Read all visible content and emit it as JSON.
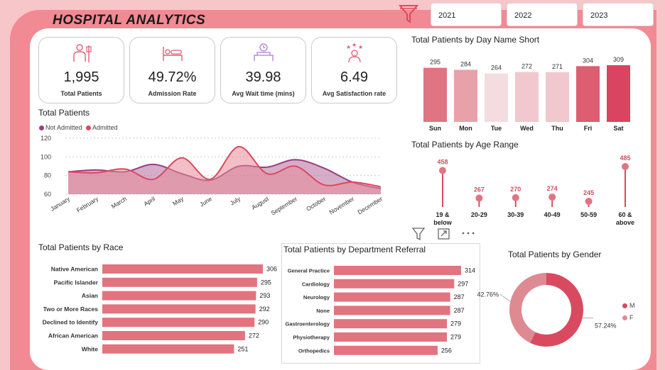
{
  "title": "HOSPITAL  ANALYTICS",
  "years": [
    "2021",
    "2022",
    "2023"
  ],
  "kpis": [
    {
      "value": "1,995",
      "label": "Total Patients",
      "icon": "patient-icon"
    },
    {
      "value": "49.72%",
      "label": "Admission Rate",
      "icon": "hospital-bed-icon"
    },
    {
      "value": "39.98",
      "label": "Avg Wait time (mins)",
      "icon": "waiting-clock-icon"
    },
    {
      "value": "6.49",
      "label": "Avg Satisfaction rate",
      "icon": "satisfaction-stars-icon"
    }
  ],
  "colors": {
    "accent": "#d94a60",
    "bar": "#e2747f",
    "purple": "#9c3d7d",
    "band": "#f28a93",
    "background": "#f7c6c9"
  },
  "total_patients": {
    "title": "Total Patients",
    "legend": [
      "Not Admitted",
      "Admitted"
    ]
  },
  "day_chart": {
    "title": "Total Patients by Day Name Short"
  },
  "age_chart": {
    "title": "Total Patients by Age Range"
  },
  "race_chart": {
    "title": "Total Patients by Race"
  },
  "dept_chart": {
    "title": "Total Patients by Department Referral"
  },
  "gender_chart": {
    "title": "Total Patients by Gender"
  },
  "chart_data": [
    {
      "type": "area",
      "title": "Total Patients",
      "categories": [
        "January",
        "February",
        "March",
        "April",
        "May",
        "June",
        "July",
        "August",
        "September",
        "October",
        "November",
        "December"
      ],
      "ylim": [
        60,
        120
      ],
      "yticks": [
        60,
        80,
        100,
        120
      ],
      "grid": true,
      "legend": "top-left",
      "series": [
        {
          "name": "Not Admitted",
          "values": [
            84,
            86,
            84,
            92,
            82,
            75,
            90,
            89,
            97,
            88,
            73,
            66
          ]
        },
        {
          "name": "Admitted",
          "values": [
            84,
            83,
            87,
            76,
            99,
            76,
            111,
            82,
            90,
            70,
            73,
            68
          ]
        }
      ]
    },
    {
      "type": "bar",
      "title": "Total Patients by Day Name Short",
      "categories": [
        "Sun",
        "Mon",
        "Tue",
        "Wed",
        "Thu",
        "Fri",
        "Sat"
      ],
      "values": [
        295,
        284,
        264,
        272,
        271,
        304,
        309
      ],
      "colors": [
        "#e07482",
        "#e8a1a9",
        "#f4dcdf",
        "#f0c8cd",
        "#f0c8cd",
        "#dc5e70",
        "#d94561"
      ]
    },
    {
      "type": "scatter",
      "title": "Total Patients by Age Range",
      "categories": [
        "19 & below",
        "20-29",
        "30-39",
        "40-49",
        "50-59",
        "60 & above"
      ],
      "values": [
        458,
        267,
        270,
        274,
        245,
        485
      ]
    },
    {
      "type": "bar",
      "title": "Total Patients by Race",
      "categories": [
        "Native American",
        "Pacific Islander",
        "Asian",
        "Two or More Races",
        "Declined to Identify",
        "African American",
        "White"
      ],
      "values": [
        306,
        295,
        293,
        292,
        290,
        272,
        251
      ]
    },
    {
      "type": "bar",
      "title": "Total Patients by Department Referral",
      "categories": [
        "General Practice",
        "Cardiology",
        "Neurology",
        "None",
        "Gastroenterology",
        "Physiotherapy",
        "Orthopedics"
      ],
      "values": [
        314,
        297,
        287,
        287,
        279,
        279,
        256
      ]
    },
    {
      "type": "pie",
      "title": "Total Patients by Gender",
      "categories": [
        "M",
        "F"
      ],
      "values": [
        57.24,
        42.76
      ],
      "labels": [
        "57.24%",
        "42.76%"
      ],
      "colors": [
        "#d94a60",
        "#de8a93"
      ]
    }
  ]
}
